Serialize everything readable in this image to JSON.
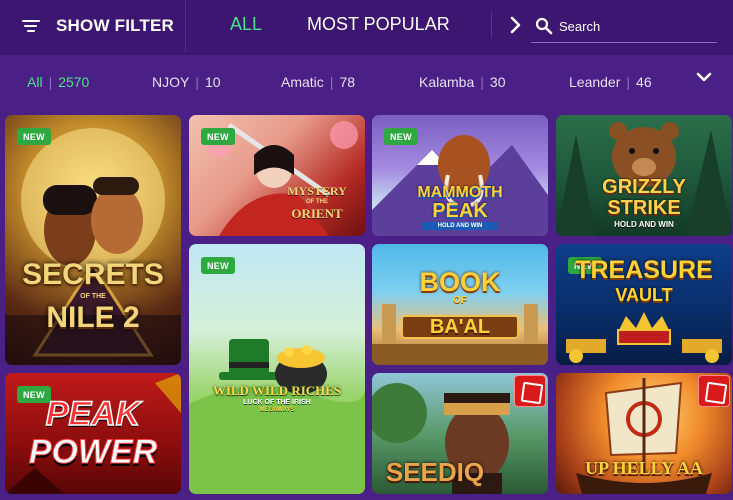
{
  "header": {
    "filter_label": "SHOW FILTER",
    "tabs": [
      "ALL",
      "MOST POPULAR"
    ],
    "active_tab": "ALL",
    "search_placeholder": "Search",
    "accent_color": "#4ee38a"
  },
  "providers": [
    {
      "name": "All",
      "count": "2570",
      "active": true
    },
    {
      "name": "NJOY",
      "count": "10"
    },
    {
      "name": "Amatic",
      "count": "78"
    },
    {
      "name": "Kalamba",
      "count": "30"
    },
    {
      "name": "Leander",
      "count": "46"
    }
  ],
  "games": [
    {
      "title_line1": "SECRETS",
      "title_small": "OF THE",
      "title_line2": "NILE 2",
      "badge": "NEW"
    },
    {
      "title_line1": "MYSTERY",
      "title_small": "OF THE",
      "title_line2": "ORIENT",
      "badge": "NEW"
    },
    {
      "title_line1": "MAMMOTH",
      "title_line2": "PEAK",
      "subtitle": "HOLD AND WIN",
      "badge": "NEW"
    },
    {
      "title_line1": "GRIZZLY",
      "title_line2": "STRIKE",
      "subtitle": "HOLD AND WIN"
    },
    {
      "title_line1": "WILD WILD RICHES",
      "subtitle": "LUCK OF THE IRISH",
      "title_small": "MEGAWAYS",
      "badge": "NEW"
    },
    {
      "title_line1": "BOOK",
      "title_small": "OF",
      "title_line2": "BA'AL"
    },
    {
      "title_line1": "TREASURE",
      "title_line2": "VAULT",
      "badge": "NEW"
    },
    {
      "title_line1": "PEAK",
      "title_line2": "POWER",
      "badge": "NEW"
    },
    {
      "title_line1": "SEEDIQ"
    },
    {
      "title_line1": "UP HELLY AA"
    }
  ]
}
